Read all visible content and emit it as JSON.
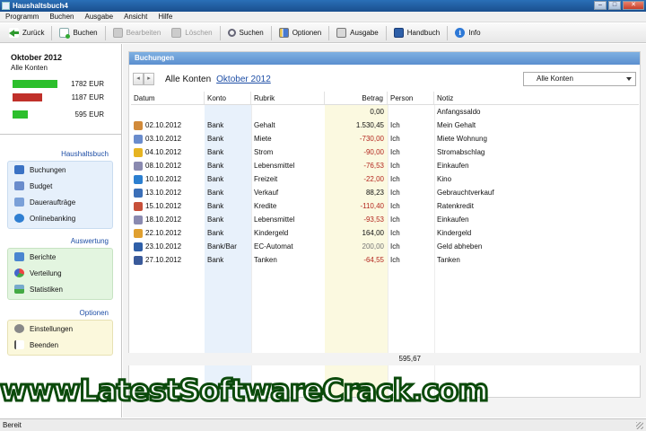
{
  "window": {
    "title": "Haushaltsbuch4"
  },
  "menu": [
    "Programm",
    "Buchen",
    "Ausgabe",
    "Ansicht",
    "Hilfe"
  ],
  "toolbar": {
    "back": "Zurück",
    "book": "Buchen",
    "edit": "Bearbeiten",
    "delete": "Löschen",
    "search": "Suchen",
    "options": "Optionen",
    "output": "Ausgabe",
    "manual": "Handbuch",
    "info": "Info"
  },
  "sidebar": {
    "month": "Oktober 2012",
    "account": "Alle Konten",
    "summary": [
      {
        "value": "1782 EUR",
        "color": "#2cbf2c",
        "fraction": 0.86
      },
      {
        "value": "1187 EUR",
        "color": "#c0302a",
        "fraction": 0.57
      },
      {
        "value": "595 EUR",
        "color": "#2cbf2c",
        "fraction": 0.29
      }
    ],
    "sections": [
      {
        "title": "Haushaltsbuch",
        "items": [
          "Buchungen",
          "Budget",
          "Daueraufträge",
          "Onlinebanking"
        ]
      },
      {
        "title": "Auswertung",
        "items": [
          "Berichte",
          "Verteilung",
          "Statistiken"
        ]
      },
      {
        "title": "Optionen",
        "items": [
          "Einstellungen",
          "Beenden"
        ]
      }
    ]
  },
  "main": {
    "panel_title": "Buchungen",
    "account_label": "Alle Konten",
    "month_link": "Oktober 2012",
    "filter_select": "Alle Konten",
    "columns": [
      "Datum",
      "Konto",
      "Rubrik",
      "Betrag",
      "Person",
      "Notiz"
    ],
    "rows": [
      {
        "date": "",
        "konto": "",
        "rubrik": "",
        "betrag": "0,00",
        "person": "",
        "notiz": "Anfangssaldo",
        "icon_color": "",
        "tone": ""
      },
      {
        "date": "02.10.2012",
        "konto": "Bank",
        "rubrik": "Gehalt",
        "betrag": "1.530,45",
        "person": "Ich",
        "notiz": "Mein Gehalt",
        "icon_color": "#d18a3a",
        "tone": ""
      },
      {
        "date": "03.10.2012",
        "konto": "Bank",
        "rubrik": "Miete",
        "betrag": "-730,00",
        "person": "Ich",
        "notiz": "Miete Wohnung",
        "icon_color": "#6a8ccc",
        "tone": "neg"
      },
      {
        "date": "04.10.2012",
        "konto": "Bank",
        "rubrik": "Strom",
        "betrag": "-90,00",
        "person": "Ich",
        "notiz": "Stromabschlag",
        "icon_color": "#e6b422",
        "tone": "neg"
      },
      {
        "date": "08.10.2012",
        "konto": "Bank",
        "rubrik": "Lebensmittel",
        "betrag": "-76,53",
        "person": "Ich",
        "notiz": "Einkaufen",
        "icon_color": "#8a8ab0",
        "tone": "neg"
      },
      {
        "date": "10.10.2012",
        "konto": "Bank",
        "rubrik": "Freizeit",
        "betrag": "-22,00",
        "person": "Ich",
        "notiz": "Kino",
        "icon_color": "#2c7fd0",
        "tone": "neg"
      },
      {
        "date": "13.10.2012",
        "konto": "Bank",
        "rubrik": "Verkauf",
        "betrag": "88,23",
        "person": "Ich",
        "notiz": "Gebrauchtverkauf",
        "icon_color": "#3b6fb8",
        "tone": ""
      },
      {
        "date": "15.10.2012",
        "konto": "Bank",
        "rubrik": "Kredite",
        "betrag": "-110,40",
        "person": "Ich",
        "notiz": "Ratenkredit",
        "icon_color": "#c7503a",
        "tone": "neg"
      },
      {
        "date": "18.10.2012",
        "konto": "Bank",
        "rubrik": "Lebensmittel",
        "betrag": "-93,53",
        "person": "Ich",
        "notiz": "Einkaufen",
        "icon_color": "#8a8ab0",
        "tone": "neg"
      },
      {
        "date": "22.10.2012",
        "konto": "Bank",
        "rubrik": "Kindergeld",
        "betrag": "164,00",
        "person": "Ich",
        "notiz": "Kindergeld",
        "icon_color": "#e0a030",
        "tone": ""
      },
      {
        "date": "23.10.2012",
        "konto": "Bank/Bar",
        "rubrik": "EC-Automat",
        "betrag": "200,00",
        "person": "Ich",
        "notiz": "Geld abheben",
        "icon_color": "#2f5fa8",
        "tone": "gray"
      },
      {
        "date": "27.10.2012",
        "konto": "Bank",
        "rubrik": "Tanken",
        "betrag": "-64,55",
        "person": "Ich",
        "notiz": "Tanken",
        "icon_color": "#3a5a9a",
        "tone": "neg"
      }
    ],
    "total": "595,67"
  },
  "watermark": "wwwLatestSoftwareCrack.com",
  "status": "Bereit"
}
